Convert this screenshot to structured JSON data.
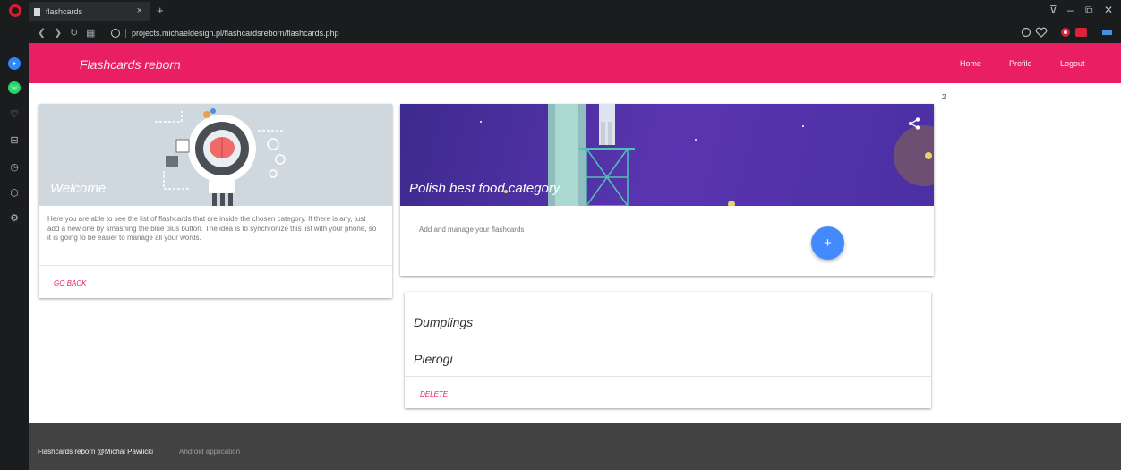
{
  "browser": {
    "tab_title": "flashcards",
    "tab_close": "×",
    "new_tab": "+",
    "url": "projects.michaeldesign.pl/flashcardsreborn/flashcards.php",
    "window_controls": [
      "⊽",
      "–",
      "⧉",
      "✕"
    ]
  },
  "sidebar": {
    "icons": [
      "messenger-icon",
      "whatsapp-icon",
      "heart-icon",
      "inbox-icon",
      "history-icon",
      "box-icon",
      "gear-icon"
    ]
  },
  "app": {
    "brand": "Flashcards reborn",
    "nav": {
      "home": "Home",
      "profile": "Profile",
      "logout": "Logout"
    },
    "accent_color": "#e91e63"
  },
  "welcome_card": {
    "title": "Welcome",
    "text": "Here you are able to see the list of flashcards that are inside the chosen category. If there is any, just add a new one by smashing the blue plus button. The idea is to synchronize this list with your phone, so it is going to be easier to manage all your words.",
    "action": "GO BACK"
  },
  "category_card": {
    "title": "Polish best food category",
    "subtitle": "Add and manage your flashcards",
    "fab_label": "+",
    "fab_color": "#448aff"
  },
  "flashcards": {
    "items": [
      "Dumplings",
      "Pierogi"
    ],
    "action": "DELETE"
  },
  "badge_count": "2",
  "footer": {
    "copyright": "Flashcards reborn @Michal Pawlicki",
    "link": "Android application"
  }
}
